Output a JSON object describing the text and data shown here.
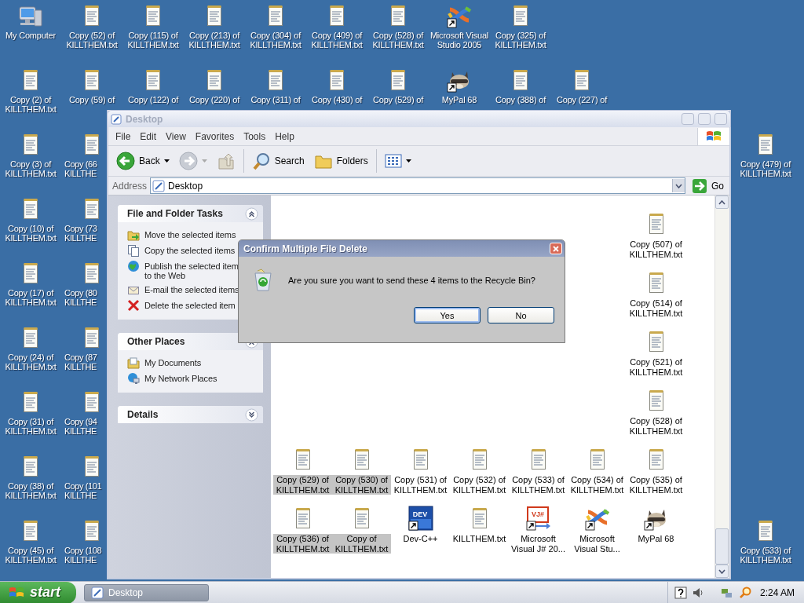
{
  "desktop": {
    "top_rows": [
      {
        "icons": [
          {
            "kind": "computer",
            "label": "My Computer",
            "shortcut": false
          },
          {
            "kind": "text",
            "label": "Copy (52) of KILLTHEM.txt",
            "shortcut": false
          },
          {
            "kind": "text",
            "label": "Copy (115) of KILLTHEM.txt",
            "shortcut": false
          },
          {
            "kind": "text",
            "label": "Copy (213) of KILLTHEM.txt",
            "shortcut": false
          },
          {
            "kind": "text",
            "label": "Copy (304) of KILLTHEM.txt",
            "shortcut": false
          },
          {
            "kind": "text",
            "label": "Copy (409) of KILLTHEM.txt",
            "shortcut": false
          },
          {
            "kind": "text",
            "label": "Copy (528) of KILLTHEM.txt",
            "shortcut": false
          },
          {
            "kind": "studio",
            "label": "Microsoft Visual Studio 2005",
            "shortcut": true
          },
          {
            "kind": "text",
            "label": "Copy (325) of KILLTHEM.txt",
            "shortcut": false
          }
        ]
      },
      {
        "icons": [
          {
            "kind": "text",
            "label": "Copy (2) of KILLTHEM.txt",
            "shortcut": false
          },
          {
            "kind": "text",
            "label": "Copy (59) of",
            "shortcut": false
          },
          {
            "kind": "text",
            "label": "Copy (122) of",
            "shortcut": false
          },
          {
            "kind": "text",
            "label": "Copy (220) of",
            "shortcut": false
          },
          {
            "kind": "text",
            "label": "Copy (311) of",
            "shortcut": false
          },
          {
            "kind": "text",
            "label": "Copy (430) of",
            "shortcut": false
          },
          {
            "kind": "text",
            "label": "Copy (529) of",
            "shortcut": false
          },
          {
            "kind": "raccoon",
            "label": "MyPal 68",
            "shortcut": true
          },
          {
            "kind": "text",
            "label": "Copy (388) of",
            "shortcut": false
          },
          {
            "kind": "text",
            "label": "Copy (227) of",
            "shortcut": false
          }
        ]
      }
    ],
    "left_rows": [
      {
        "icons": [
          {
            "kind": "text",
            "label": "Copy (3) of KILLTHEM.txt",
            "shortcut": false
          },
          {
            "kind": "text",
            "label": "Copy (66 KILLTHE",
            "shortcut": false
          }
        ]
      },
      {
        "icons": [
          {
            "kind": "text",
            "label": "Copy (10) of KILLTHEM.txt",
            "shortcut": false
          },
          {
            "kind": "text",
            "label": "Copy (73 KILLTHE",
            "shortcut": false
          }
        ]
      },
      {
        "icons": [
          {
            "kind": "text",
            "label": "Copy (17) of KILLTHEM.txt",
            "shortcut": false
          },
          {
            "kind": "text",
            "label": "Copy (80 KILLTHE",
            "shortcut": false
          }
        ]
      },
      {
        "icons": [
          {
            "kind": "text",
            "label": "Copy (24) of KILLTHEM.txt",
            "shortcut": false
          },
          {
            "kind": "text",
            "label": "Copy (87 KILLTHE",
            "shortcut": false
          }
        ]
      },
      {
        "icons": [
          {
            "kind": "text",
            "label": "Copy (31) of KILLTHEM.txt",
            "shortcut": false
          },
          {
            "kind": "text",
            "label": "Copy (94 KILLTHE",
            "shortcut": false
          }
        ]
      },
      {
        "icons": [
          {
            "kind": "text",
            "label": "Copy (38) of KILLTHEM.txt",
            "shortcut": false
          },
          {
            "kind": "text",
            "label": "Copy (101 KILLTHE",
            "shortcut": false
          }
        ]
      },
      {
        "icons": [
          {
            "kind": "text",
            "label": "Copy (45) of KILLTHEM.txt",
            "shortcut": false
          },
          {
            "kind": "text",
            "label": "Copy (108 KILLTHE",
            "shortcut": false
          }
        ]
      }
    ],
    "right_icons": [
      {
        "kind": "text",
        "label": "Copy (479) of KILLTHEM.txt",
        "shortcut": false
      },
      {
        "kind": "text",
        "label": "Copy (533) of KILLTHEM.txt",
        "shortcut": false
      }
    ]
  },
  "explorer": {
    "title": "Desktop",
    "menu": [
      "File",
      "Edit",
      "View",
      "Favorites",
      "Tools",
      "Help"
    ],
    "toolbar": {
      "back": {
        "label": "Back",
        "disabled": false
      },
      "forward": {
        "disabled": true
      },
      "search": "Search",
      "folders": "Folders"
    },
    "address": {
      "label": "Address",
      "value": "Desktop",
      "go": "Go"
    },
    "panels": [
      {
        "title": "File and Folder Tasks",
        "expanded": true,
        "items": [
          {
            "kind": "move",
            "lines": [
              "Move the selected items"
            ]
          },
          {
            "kind": "copy",
            "lines": [
              "Copy the selected items"
            ]
          },
          {
            "kind": "publish",
            "lines": [
              "Publish the selected item",
              "to the Web"
            ]
          },
          {
            "kind": "email",
            "lines": [
              "E-mail the selected items"
            ]
          },
          {
            "kind": "delete",
            "lines": [
              "Delete the selected item"
            ]
          }
        ]
      },
      {
        "title": "Other Places",
        "expanded": true,
        "items": [
          {
            "kind": "documents",
            "lines": [
              "My Documents"
            ]
          },
          {
            "kind": "network",
            "lines": [
              "My Network Places"
            ]
          }
        ]
      },
      {
        "title": "Details",
        "expanded": false
      }
    ],
    "file_rows": [
      {
        "items": [
          {
            "kind": "text",
            "label": "Copy (507) of KILLTHEM.txt",
            "selected": false,
            "shortcut": false
          }
        ]
      },
      {
        "items": [
          {
            "kind": "text",
            "label": "Copy (514) of KILLTHEM.txt",
            "selected": false,
            "shortcut": false
          }
        ]
      },
      {
        "items": [
          {
            "kind": "text",
            "label": "Copy (521) of KILLTHEM.txt",
            "selected": false,
            "shortcut": false
          }
        ]
      },
      {
        "items": [
          {
            "kind": "text",
            "label": "Copy (528) of KILLTHEM.txt",
            "selected": false,
            "shortcut": false
          }
        ]
      },
      {
        "items": [
          {
            "kind": "text",
            "label": "Copy (529) of KILLTHEM.txt",
            "selected": true,
            "shortcut": false
          },
          {
            "kind": "text",
            "label": "Copy (530) of KILLTHEM.txt",
            "selected": true,
            "shortcut": false
          },
          {
            "kind": "text",
            "label": "Copy (531) of KILLTHEM.txt",
            "selected": false,
            "shortcut": false
          },
          {
            "kind": "text",
            "label": "Copy (532) of KILLTHEM.txt",
            "selected": false,
            "shortcut": false
          },
          {
            "kind": "text",
            "label": "Copy (533) of KILLTHEM.txt",
            "selected": false,
            "shortcut": false
          },
          {
            "kind": "text",
            "label": "Copy (534) of KILLTHEM.txt",
            "selected": false,
            "shortcut": false
          },
          {
            "kind": "text",
            "label": "Copy (535) of KILLTHEM.txt",
            "selected": false,
            "shortcut": false
          }
        ]
      },
      {
        "items": [
          {
            "kind": "text",
            "label": "Copy (536) of KILLTHEM.txt",
            "selected": true,
            "shortcut": false
          },
          {
            "kind": "text",
            "label": "Copy of KILLTHEM.txt",
            "selected": true,
            "shortcut": false
          },
          {
            "kind": "dev",
            "label": "Dev-C++",
            "selected": false,
            "shortcut": true,
            "icon_text": "DEV"
          },
          {
            "kind": "text",
            "label": "KILLTHEM.txt",
            "selected": false,
            "shortcut": false
          },
          {
            "kind": "vj",
            "label": "Microsoft Visual J# 20...",
            "selected": false,
            "shortcut": true,
            "icon_text": "VJ#"
          },
          {
            "kind": "studio",
            "label": "Microsoft Visual Stu...",
            "selected": false,
            "shortcut": true
          },
          {
            "kind": "raccoon",
            "label": "MyPal 68",
            "selected": false,
            "shortcut": true
          }
        ]
      }
    ]
  },
  "dialog": {
    "title": "Confirm Multiple File Delete",
    "message": "Are you sure you want to send these 4 items to the Recycle Bin?",
    "buttons": [
      {
        "label": "Yes",
        "default": true
      },
      {
        "label": "No",
        "default": false
      }
    ]
  },
  "taskbar": {
    "start": "start",
    "tasks": [
      {
        "label": "Desktop",
        "selected": false
      }
    ],
    "time": "2:24 AM"
  }
}
